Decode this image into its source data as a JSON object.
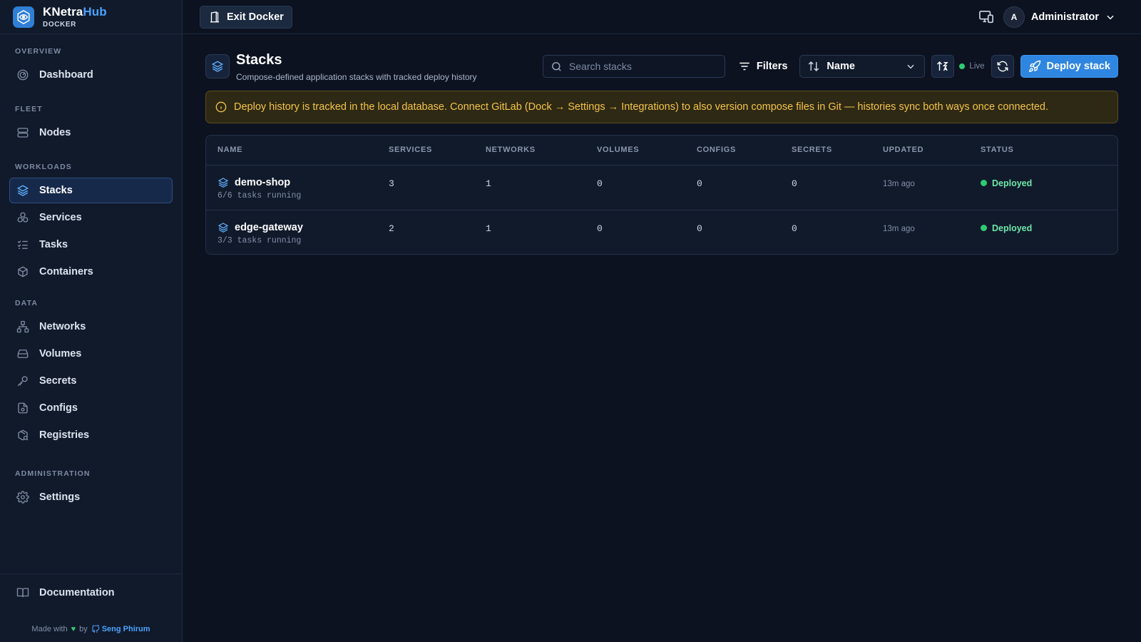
{
  "brand": {
    "title_main": "KNetra",
    "title_accent": "Hub",
    "subtitle": "DOCKER"
  },
  "sidebar": {
    "sections": [
      {
        "heading": "OVERVIEW",
        "items": [
          {
            "label": "Dashboard",
            "icon": "dashboard-icon"
          }
        ]
      },
      {
        "heading": "FLEET",
        "items": [
          {
            "label": "Nodes",
            "icon": "server-icon"
          }
        ]
      },
      {
        "heading": "WORKLOADS",
        "items": [
          {
            "label": "Stacks",
            "icon": "layers-icon",
            "active": true
          },
          {
            "label": "Services",
            "icon": "services-icon"
          },
          {
            "label": "Tasks",
            "icon": "tasks-icon"
          },
          {
            "label": "Containers",
            "icon": "box-icon"
          }
        ]
      },
      {
        "heading": "DATA",
        "items": [
          {
            "label": "Networks",
            "icon": "network-icon"
          },
          {
            "label": "Volumes",
            "icon": "drive-icon"
          },
          {
            "label": "Secrets",
            "icon": "key-icon"
          },
          {
            "label": "Configs",
            "icon": "file-icon"
          },
          {
            "label": "Registries",
            "icon": "package-icon"
          }
        ]
      },
      {
        "heading": "ADMINISTRATION",
        "items": [
          {
            "label": "Settings",
            "icon": "gear-icon"
          }
        ]
      }
    ],
    "footer": {
      "docs_label": "Documentation",
      "made_with": "Made with",
      "by": "by",
      "author": "Seng Phirum"
    }
  },
  "topbar": {
    "exit_label": "Exit Docker",
    "user_initial": "A",
    "user_name": "Administrator"
  },
  "page": {
    "title": "Stacks",
    "subtitle": "Compose-defined application stacks with tracked deploy history",
    "search_placeholder": "Search stacks",
    "filters_label": "Filters",
    "sort_label": "Name",
    "live_label": "Live",
    "deploy_label": "Deploy stack",
    "banner": "Deploy history is tracked in the local database. Connect GitLab (Dock → Settings → Integrations) to also version compose files in Git — histories sync both ways once connected."
  },
  "table": {
    "columns": [
      "NAME",
      "SERVICES",
      "NETWORKS",
      "VOLUMES",
      "CONFIGS",
      "SECRETS",
      "UPDATED",
      "STATUS"
    ],
    "rows": [
      {
        "name": "demo-shop",
        "tasks": "6/6 tasks running",
        "services": "3",
        "networks": "1",
        "volumes": "0",
        "configs": "0",
        "secrets": "0",
        "updated": "13m ago",
        "status": "Deployed"
      },
      {
        "name": "edge-gateway",
        "tasks": "3/3 tasks running",
        "services": "2",
        "networks": "1",
        "volumes": "0",
        "configs": "0",
        "secrets": "0",
        "updated": "13m ago",
        "status": "Deployed"
      }
    ]
  },
  "colors": {
    "accent": "#2f86e0",
    "brand_accent": "#4aa3ff",
    "success": "#2ecc71",
    "warning_text": "#f5c44a",
    "background": "#0c1220"
  }
}
